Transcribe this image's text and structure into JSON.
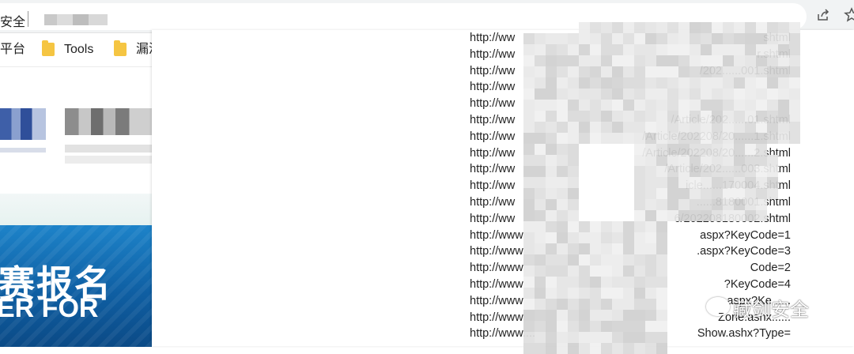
{
  "browser": {
    "tab_title": "安全",
    "share_icon": "share-icon",
    "star_icon": "star-icon"
  },
  "bookmarks": [
    {
      "label": "平台",
      "icon": "none"
    },
    {
      "label": "Tools",
      "icon": "folder-icon"
    },
    {
      "label": "漏洞",
      "icon": "folder-icon"
    }
  ],
  "background_page": {
    "banner_cn": "赛报名",
    "banner_en": "ER FOR"
  },
  "url_list": [
    "http://ww",
    "http://ww",
    "http://ww",
    "http://ww",
    "http://ww",
    "http://ww",
    "http://ww",
    "http://ww",
    "http://ww",
    "http://ww",
    "http://ww",
    "http://ww",
    "http://www",
    "http://www",
    "http://www",
    "http://www",
    "http://www",
    "http://www",
    "http://www...."
  ],
  "url_suffixes": [
    "shtml",
    "r.shtml",
    "/202......001.shtml",
    "",
    "",
    "/Article/202......01.shtml",
    "/Article/202208/20......1.shtml",
    "/Article/202208/20......2.shtml",
    "/Article/202......003.shtml",
    "icle......170004.shtml",
    "......8180001.shtml",
    "6/202208180002.shtml",
    "aspx?KeyCode=1",
    ".aspx?KeyCode=3",
    "Code=2",
    "?KeyCode=4",
    "aspx?Ke......",
    "Zone.ashx......",
    "Show.ashx?Type="
  ],
  "watermark": {
    "text": "藏剑安全",
    "icon": "wechat-icon"
  },
  "colors": {
    "toolbar_bg": "#f1f3f4",
    "folder": "#f5c542",
    "banner_blue": "#0f5fa3"
  }
}
